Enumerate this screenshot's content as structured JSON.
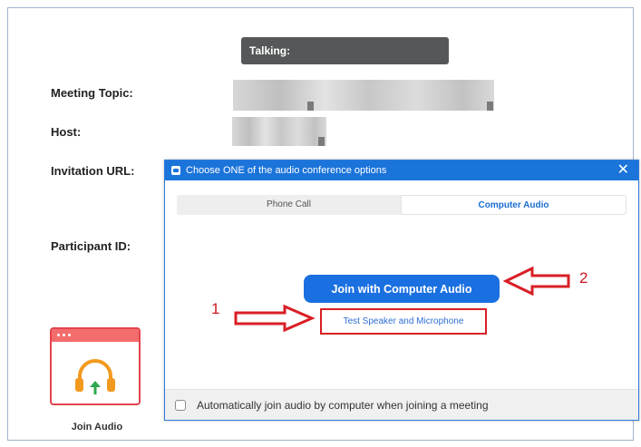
{
  "meeting": {
    "talking_label": "Talking:",
    "topic_label": "Meeting Topic:",
    "host_label": "Host:",
    "url_label": "Invitation URL:",
    "participant_label": "Participant ID:"
  },
  "join_audio": {
    "label": "Join Audio",
    "icon": "headphones-icon"
  },
  "dialog": {
    "title": "Choose ONE of the audio conference options",
    "close_glyph": "✕",
    "tabs": [
      {
        "label": "Phone Call",
        "active": false
      },
      {
        "label": "Computer Audio",
        "active": true
      }
    ],
    "join_button_label": "Join with Computer Audio",
    "test_link_label": "Test Speaker and Microphone",
    "auto_join_label": "Automatically join audio by computer when joining a meeting"
  },
  "annotations": {
    "step1": "1",
    "step2": "2",
    "color": "#d81f26"
  },
  "colors": {
    "accent": "#1a70e0",
    "tile_red": "#e4434d",
    "headphone_orange": "#f29a1f",
    "arrow_green": "#2fa84f"
  }
}
